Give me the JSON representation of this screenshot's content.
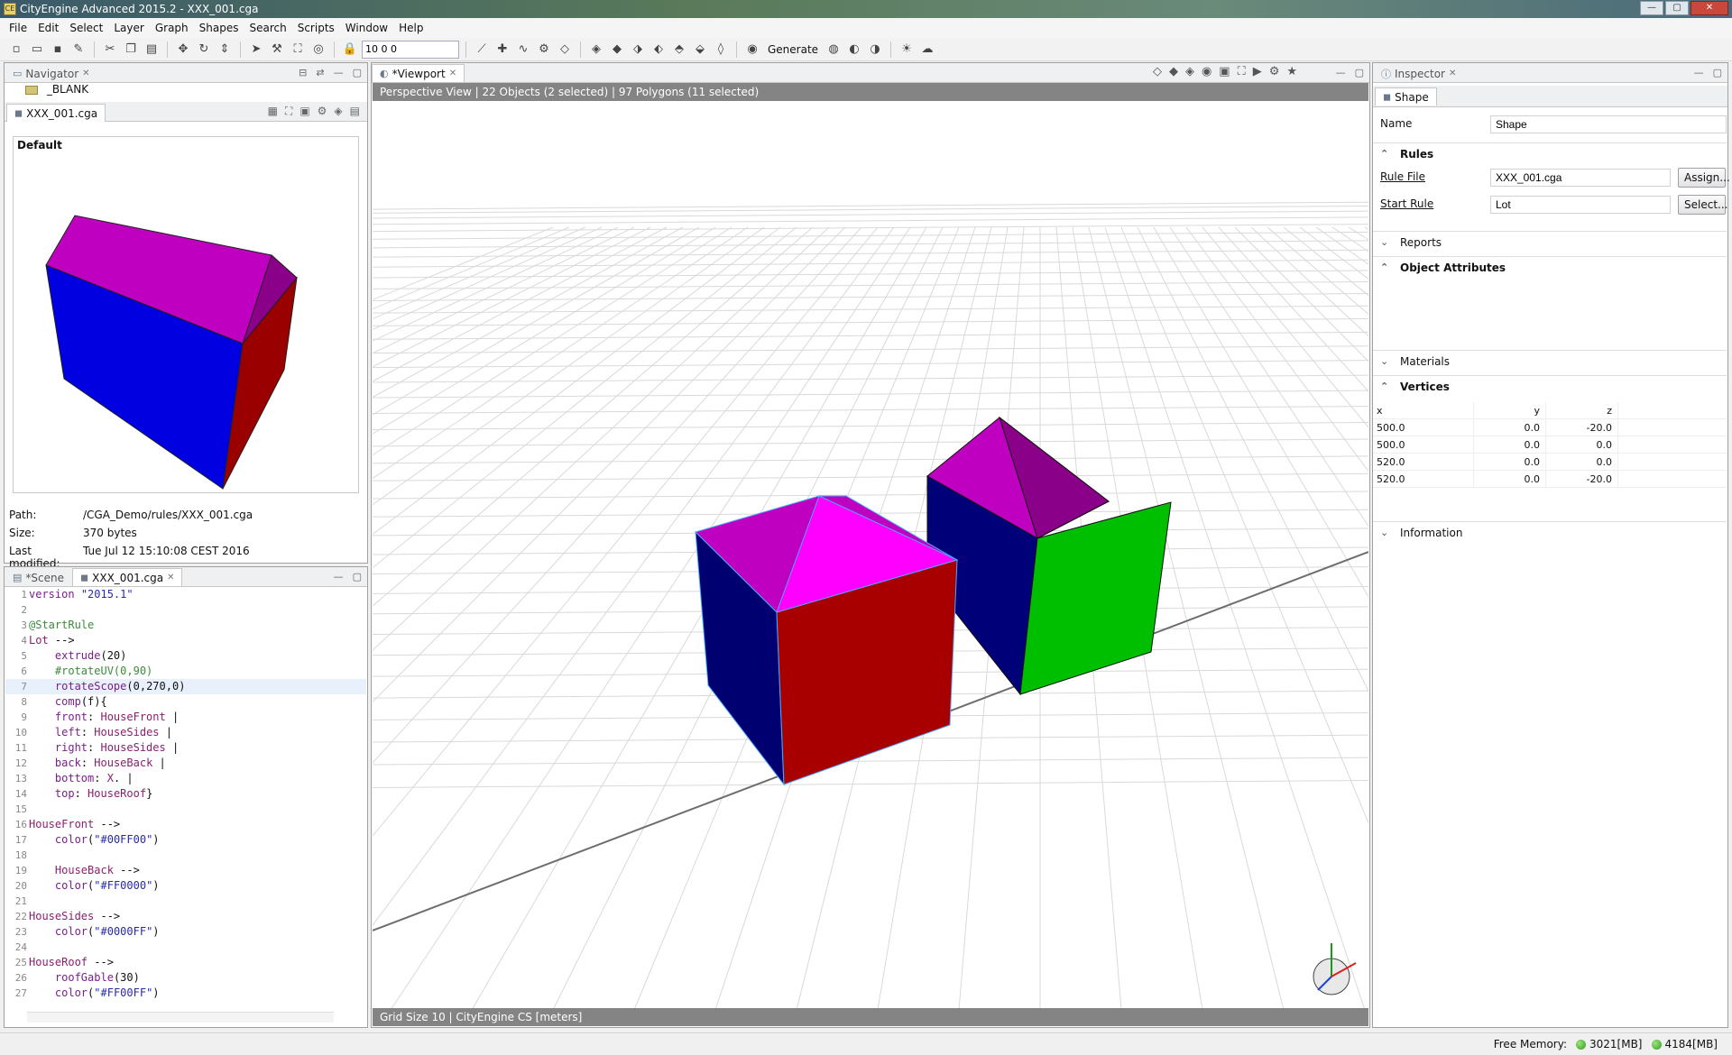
{
  "window": {
    "title": "CityEngine Advanced 2015.2 - XXX_001.cga"
  },
  "menu": [
    "File",
    "Edit",
    "Select",
    "Layer",
    "Graph",
    "Shapes",
    "Search",
    "Scripts",
    "Window",
    "Help"
  ],
  "toolbar": {
    "zoom_value": "10 0 0",
    "generate_label": "Generate"
  },
  "navigator": {
    "tab_label": "Navigator",
    "folder": "_BLANK",
    "file_tab": "XXX_001.cga",
    "preview_label": "Default",
    "path_key": "Path:",
    "path": "/CGA_Demo/rules/XXX_001.cga",
    "size_key": "Size:",
    "size": "370 bytes",
    "modified_key": "Last modified:",
    "modified": "Tue Jul 12 15:10:08 CEST 2016"
  },
  "editor": {
    "tab_scene": "*Scene",
    "tab_file": "XXX_001.cga",
    "lines": [
      "version \"2015.1\"",
      "",
      "@StartRule",
      "Lot -->",
      "    extrude(20)",
      "    #rotateUV(0,90)",
      "    rotateScope(0,270,0)",
      "    comp(f){",
      "    front: HouseFront |",
      "    left: HouseSides |",
      "    right: HouseSides |",
      "    back: HouseBack |",
      "    bottom: X. |",
      "    top: HouseRoof}",
      "",
      "HouseFront -->",
      "    color(\"#00FF00\")",
      "",
      "    HouseBack -->",
      "    color(\"#FF0000\")",
      "",
      "HouseSides -->",
      "    color(\"#0000FF\")",
      "",
      "HouseRoof -->",
      "    roofGable(30)",
      "    color(\"#FF00FF\")"
    ]
  },
  "viewport": {
    "tab_label": "*Viewport",
    "status": "Perspective View  |  22 Objects  (2 selected)  |  97 Polygons  (11 selected)",
    "footer": "Grid Size 10  |  CityEngine CS [meters]"
  },
  "inspector": {
    "tab_label": "Inspector",
    "shape_tab": "Shape",
    "name_label": "Name",
    "name_value": "Shape",
    "rules_label": "Rules",
    "rule_file_label": "Rule File",
    "rule_file_value": "XXX_001.cga",
    "assign_button": "Assign...",
    "start_rule_label": "Start Rule",
    "start_rule_value": "Lot",
    "select_button": "Select...",
    "reports_label": "Reports",
    "object_attributes_label": "Object Attributes",
    "materials_label": "Materials",
    "vertices_label": "Vertices",
    "vertices_headers": [
      "x",
      "y",
      "z"
    ],
    "vertices": [
      [
        "500.0",
        "0.0",
        "-20.0"
      ],
      [
        "500.0",
        "0.0",
        "0.0"
      ],
      [
        "520.0",
        "0.0",
        "0.0"
      ],
      [
        "520.0",
        "0.0",
        "-20.0"
      ]
    ],
    "information_label": "Information"
  },
  "statusbar": {
    "free_memory_label": "Free Memory:",
    "mem1": "3021[MB]",
    "mem2": "4184[MB]"
  },
  "colors": {
    "front": "#00FF00",
    "back": "#FF0000",
    "sides": "#0000FF",
    "roof": "#FF00FF"
  }
}
